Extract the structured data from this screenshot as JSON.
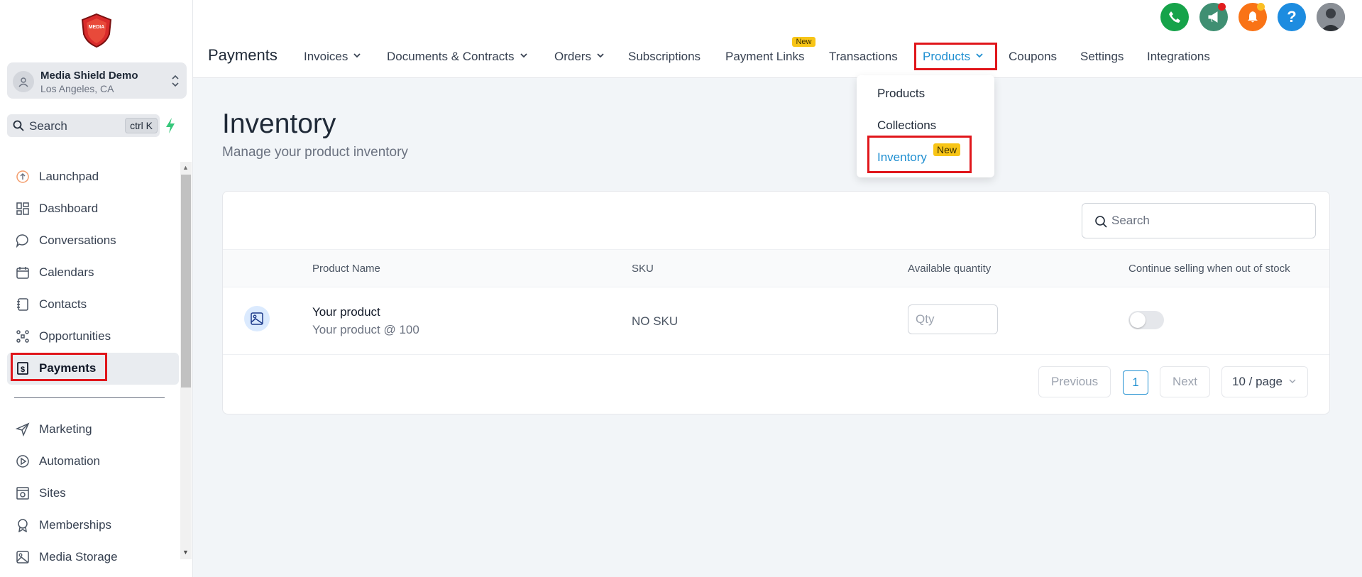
{
  "brand": {
    "logo_text": "MEDIA"
  },
  "account": {
    "name": "Media Shield Demo",
    "location": "Los Angeles, CA"
  },
  "sidebar_search": {
    "label": "Search",
    "shortcut": "ctrl K"
  },
  "sidebar": {
    "items": [
      {
        "label": "Launchpad",
        "icon": "launchpad-icon"
      },
      {
        "label": "Dashboard",
        "icon": "dashboard-icon"
      },
      {
        "label": "Conversations",
        "icon": "chat-icon"
      },
      {
        "label": "Calendars",
        "icon": "calendar-icon"
      },
      {
        "label": "Contacts",
        "icon": "contacts-icon"
      },
      {
        "label": "Opportunities",
        "icon": "opportunities-icon"
      },
      {
        "label": "Payments",
        "icon": "payments-icon",
        "active": true
      }
    ],
    "items2": [
      {
        "label": "Marketing",
        "icon": "send-icon"
      },
      {
        "label": "Automation",
        "icon": "automation-icon"
      },
      {
        "label": "Sites",
        "icon": "sites-icon"
      },
      {
        "label": "Memberships",
        "icon": "membership-icon"
      },
      {
        "label": "Media Storage",
        "icon": "image-icon"
      }
    ]
  },
  "header": {
    "title": "Payments",
    "tabs": [
      {
        "label": "Invoices",
        "dropdown": true
      },
      {
        "label": "Documents & Contracts",
        "dropdown": true
      },
      {
        "label": "Orders",
        "dropdown": true
      },
      {
        "label": "Subscriptions"
      },
      {
        "label": "Payment Links",
        "badge": "New"
      },
      {
        "label": "Transactions"
      },
      {
        "label": "Products",
        "dropdown": true,
        "active": true
      },
      {
        "label": "Coupons"
      },
      {
        "label": "Settings"
      },
      {
        "label": "Integrations"
      }
    ],
    "icons": [
      "phone-icon",
      "megaphone-icon",
      "bell-icon",
      "help-icon",
      "user-avatar"
    ],
    "colors": {
      "phone": "#16a34a",
      "megaphone": "#3f8f72",
      "bell": "#f97316",
      "help": "#1d8ce0"
    }
  },
  "products_menu": {
    "items": [
      {
        "label": "Products"
      },
      {
        "label": "Collections"
      },
      {
        "label": "Inventory",
        "badge": "New",
        "active": true
      }
    ]
  },
  "main": {
    "title": "Inventory",
    "subtitle": "Manage your product inventory",
    "search_placeholder": "Search",
    "columns": [
      "Product Name",
      "SKU",
      "Available quantity",
      "Continue selling when out of stock"
    ],
    "rows": [
      {
        "name": "Your product",
        "detail": "Your product @ 100",
        "sku": "NO SKU",
        "qty_placeholder": "Qty",
        "continue_selling": false
      }
    ],
    "pagination": {
      "previous": "Previous",
      "page": "1",
      "next": "Next",
      "page_size": "10 / page"
    }
  },
  "accent_color": "#1f8fd1",
  "highlight_color": "#e0161b"
}
